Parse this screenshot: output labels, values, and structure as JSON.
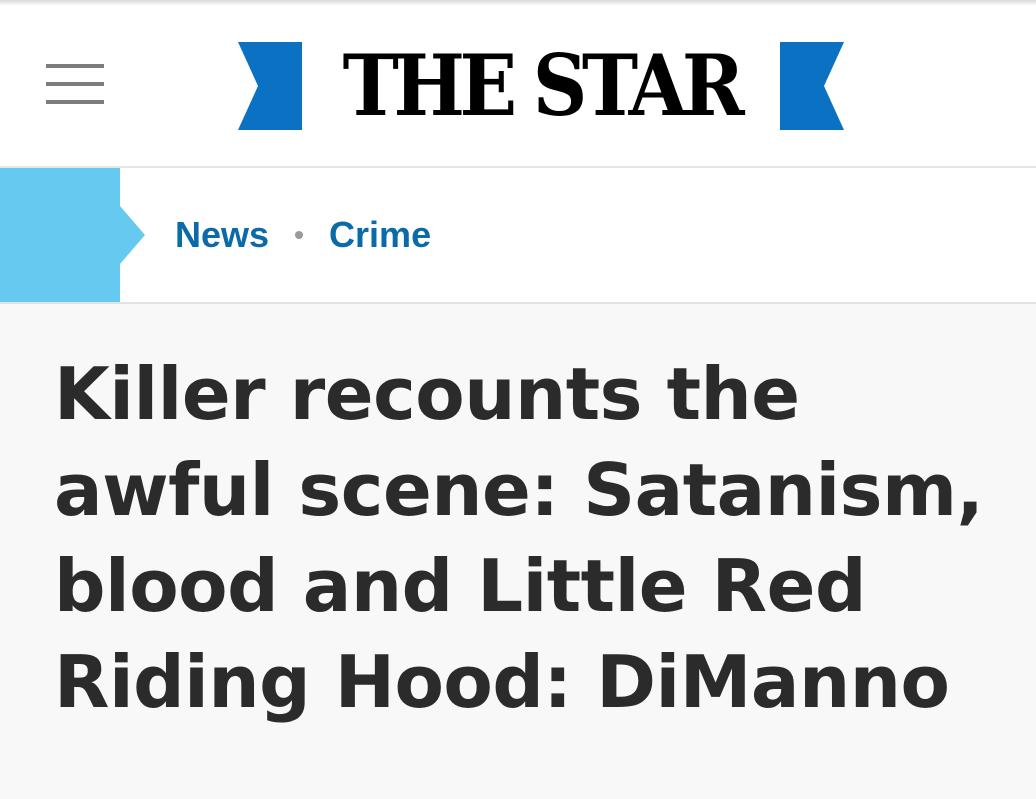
{
  "header": {
    "logo_text": "THE STAR",
    "brand_color": "#0b72c3",
    "menu_icon": "hamburger-menu-icon"
  },
  "breadcrumb": {
    "accent_color": "#66c9ef",
    "link_color": "#0b6aa8",
    "items": [
      {
        "label": "News"
      },
      {
        "label": "Crime"
      }
    ]
  },
  "article": {
    "headline": "Killer recounts the awful scene: Satanism, blood and Little Red Riding Hood: DiManno"
  }
}
